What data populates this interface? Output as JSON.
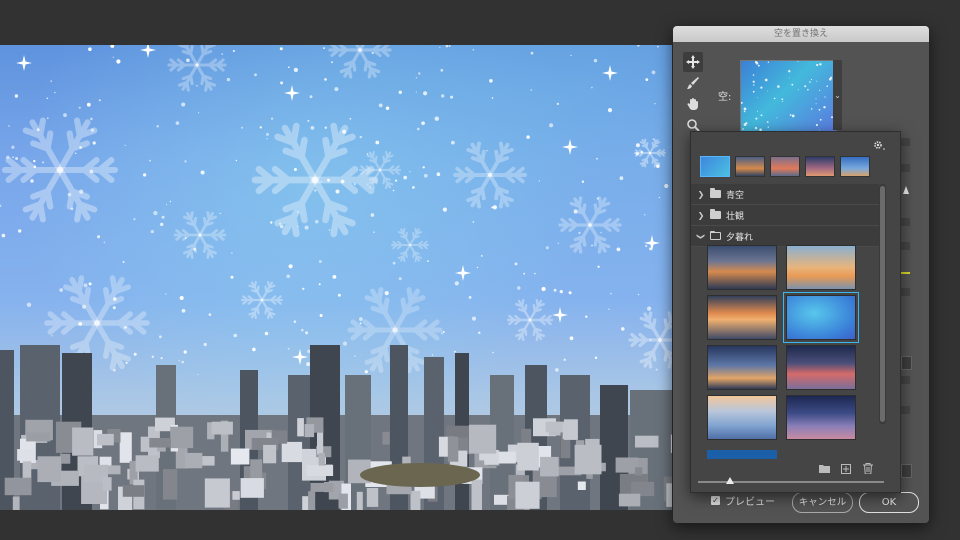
{
  "dialog": {
    "title": "空を置き換え",
    "sky_label": "空:",
    "preview_label": "プレビュー",
    "preview_checked": true,
    "cancel_label": "キャンセル",
    "ok_label": "OK"
  },
  "tools": [
    {
      "name": "move-icon",
      "active": true
    },
    {
      "name": "sky-brush-icon",
      "active": false
    },
    {
      "name": "hand-icon",
      "active": false
    },
    {
      "name": "zoom-icon",
      "active": false
    }
  ],
  "presets": {
    "folders": [
      {
        "label": "青空",
        "expanded": false
      },
      {
        "label": "壮観",
        "expanded": false
      },
      {
        "label": "夕暮れ",
        "expanded": true
      }
    ],
    "thumbnails": [
      {
        "name": "sunset-1"
      },
      {
        "name": "sunset-2"
      },
      {
        "name": "sunset-3"
      },
      {
        "name": "snow-sky",
        "selected": true
      },
      {
        "name": "sunset-4"
      },
      {
        "name": "sunset-5"
      },
      {
        "name": "sunset-6"
      },
      {
        "name": "sunset-7"
      }
    ],
    "thumbnail_size_fraction": 0.17
  },
  "colors": {
    "selection_accent": "#38b8ef",
    "dialog_bg": "#535353",
    "app_bg": "#323232"
  }
}
